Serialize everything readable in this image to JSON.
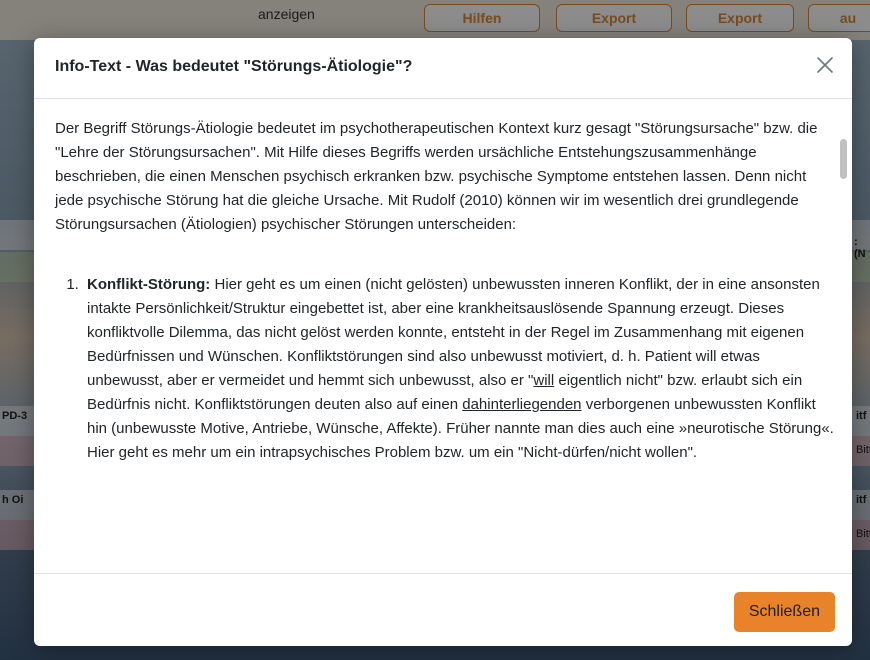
{
  "background": {
    "label": "anzeigen",
    "buttons": [
      "Hilfen",
      "Export",
      "Export",
      "au"
    ],
    "left_edge": [
      "PD-3",
      "h Oi"
    ],
    "right_edge": [
      ": (N",
      "itf",
      "Bitt",
      "itf",
      "Bitt"
    ]
  },
  "modal": {
    "title": "Info-Text - Was bedeutet \"Störungs-Ätiologie\"?",
    "close_symbol": "×",
    "intro": "Der Begriff Störungs-Ätiologie bedeutet im psychotherapeutischen Kontext kurz gesagt \"Störungsursache\" bzw. die \"Lehre der Störungsursachen\". Mit Hilfe dieses Begriffs werden ursächliche Entstehungszusammenhänge beschrieben, die einen Menschen psychisch erkranken bzw. psychische Symptome entstehen lassen. Denn nicht jede psychische Störung hat die gleiche Ursache. Mit Rudolf (2010) können wir im wesentlich drei grundlegende Störungsursachen (Ätiologien) psychischer Störungen unterscheiden:",
    "item1": {
      "term": "Konflikt-Störung:",
      "text_a": " Hier geht es um einen (nicht gelösten) unbewussten inneren Konflikt, der in eine ansonsten intakte Persönlichkeit/Struktur eingebettet ist, aber eine krankheitsauslösende Spannung erzeugt. Dieses konfliktvolle Dilemma, das nicht gelöst werden konnte, entsteht in der Regel im Zusammenhang mit eigenen Bedürfnissen und Wünschen. Konfliktstörungen sind also unbewusst motiviert, d. h. Patient will etwas unbewusst, aber er vermeidet und hemmt sich unbewusst, also er \"",
      "underline_a": "will",
      "text_b": " eigentlich nicht\" bzw. erlaubt sich ein Bedürfnis nicht. Konfliktstörungen deuten also auf einen ",
      "underline_b": "dahinterliegenden",
      "text_c": " verborgenen unbewussten Konflikt hin (unbewusste Motive, Antriebe, Wünsche, Affekte). Früher nannte man dies auch eine »neurotische Störung«. Hier geht es mehr um ein intrapsychisches Problem bzw. um ein \"Nicht-dürfen/nicht wollen\"."
    },
    "footer_button": "Schließen"
  },
  "colors": {
    "accent": "#e8832a",
    "overlay": "rgba(0,0,0,0.45)"
  }
}
